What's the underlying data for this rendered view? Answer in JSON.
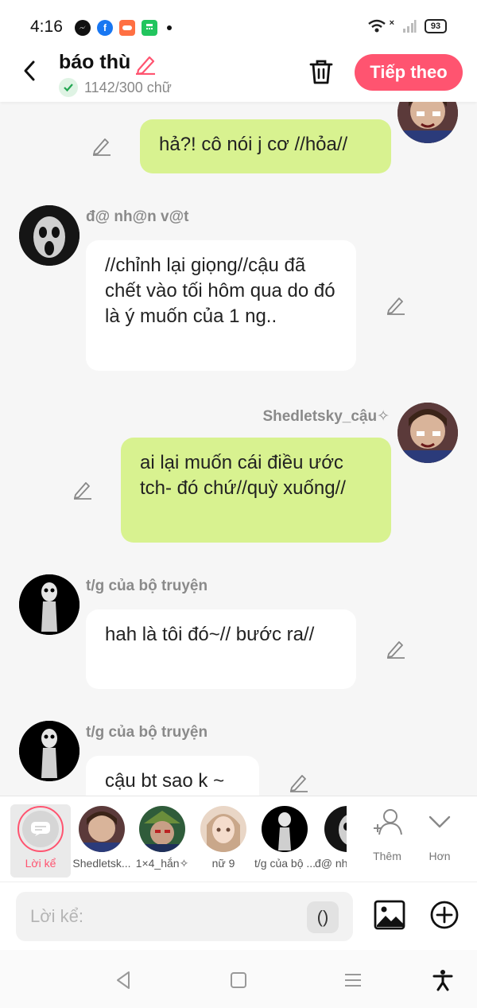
{
  "status_bar": {
    "time": "4:16",
    "battery": "93",
    "apps": [
      "messenger-icon",
      "facebook-icon",
      "game-icon",
      "calculator-icon"
    ],
    "signal_mark": "×"
  },
  "header": {
    "title": "báo thù",
    "word_count": "1142/300 chữ",
    "next_label": "Tiếp theo"
  },
  "messages": [
    {
      "side": "right",
      "sender": "Shedletsky_cậu✧",
      "text": "hả?! cô nói j cơ //hỏa//"
    },
    {
      "side": "left",
      "sender": "đ@ nh@n v@t",
      "text": "//chỉnh lại giọng//cậu đã chết vào tối hôm qua do đó là ý muốn của 1 ng.."
    },
    {
      "side": "right",
      "sender": "Shedletsky_cậu✧",
      "text": "ai lại muốn cái điều ước tch- đó chứ//quỳ xuống//"
    },
    {
      "side": "left",
      "sender": "t/g của bộ truyện",
      "text": "hah là tôi đó~// bước ra//"
    },
    {
      "side": "left",
      "sender": "t/g của bộ truyện",
      "text": "cậu bt sao k ~"
    }
  ],
  "characters": [
    {
      "label": "Lời kể"
    },
    {
      "label": "Shedletsk..."
    },
    {
      "label": "1×4_hắn✧"
    },
    {
      "label": "nữ 9"
    },
    {
      "label": "t/g của bộ ..."
    },
    {
      "label": "đ@ nh"
    }
  ],
  "tools": {
    "more_label": "Thêm",
    "less_label": "Hơn"
  },
  "input": {
    "placeholder": "Lời kể:",
    "paren_label": "()"
  },
  "colors": {
    "accent": "#ff5470",
    "right_bubble": "#d8f290",
    "left_bubble": "#ffffff",
    "background": "#f6f6f6"
  }
}
